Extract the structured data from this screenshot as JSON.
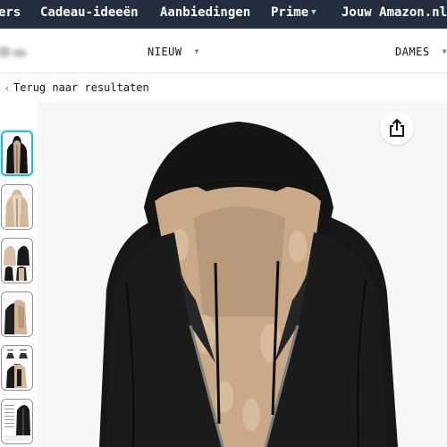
{
  "top_nav": {
    "items": [
      {
        "label": "ers",
        "has_caret": false
      },
      {
        "label": "Cadeau-ideeën",
        "has_caret": false
      },
      {
        "label": "Aanbiedingen",
        "has_caret": false
      },
      {
        "label": "Prime",
        "has_caret": true
      },
      {
        "label": "Jouw Amazon.nl",
        "has_caret": false
      }
    ],
    "background": "#232f3e"
  },
  "store_bar": {
    "tabs": [
      {
        "label": "NIEUW",
        "has_caret": true
      },
      {
        "label": "DAMES",
        "has_caret": true
      }
    ]
  },
  "back_link": {
    "label": "Terug naar resultaten"
  },
  "gallery": {
    "thumbnails": [
      {
        "subject": "black hoodie front, selected",
        "active": true
      },
      {
        "subject": "beige hoodie",
        "active": false
      },
      {
        "subject": "hoodie variants",
        "active": false
      },
      {
        "subject": "hoodie detail",
        "active": false
      },
      {
        "subject": "size chart",
        "active": false
      },
      {
        "subject": "size table",
        "active": false
      }
    ],
    "selected_color": "#2eb5c9",
    "main_image_subject": "black zip-up hoodie with beige sherpa fleece lining",
    "share_icon": "share-icon"
  }
}
